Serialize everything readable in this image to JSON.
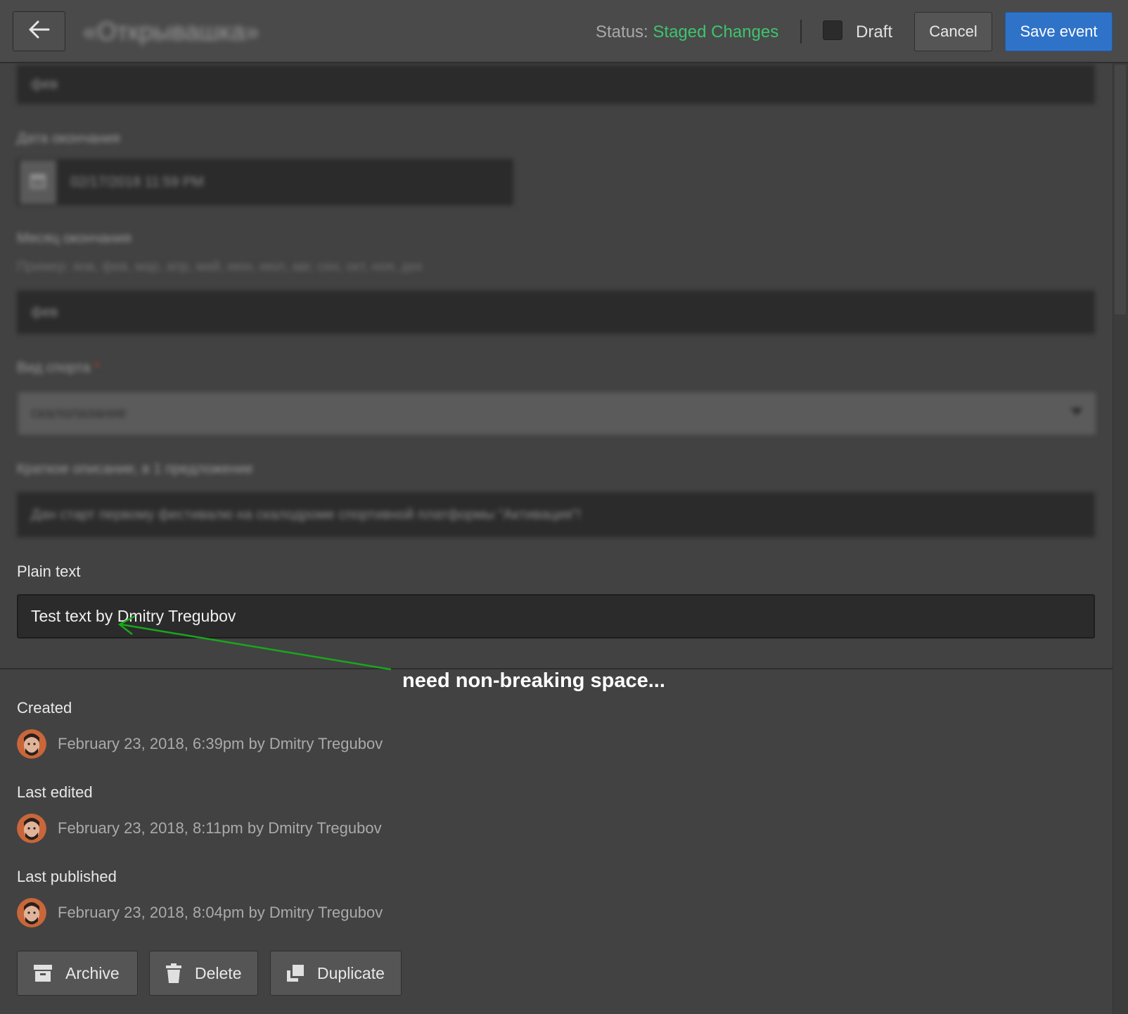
{
  "header": {
    "title": "«Открывашка»",
    "status_label": "Status:",
    "status_value": "Staged Changes",
    "draft_label": "Draft",
    "cancel_label": "Cancel",
    "save_label": "Save event"
  },
  "form": {
    "field_top_value": "фев",
    "end_date_label": "Дата окончания",
    "end_date_value": "02/17/2018 11:59 PM",
    "end_month_label": "Месяц окончания",
    "end_month_hint": "Пример: янв, фев, мар, апр, май, июн, июл, авг, сен, окт, ноя, дек",
    "end_month_value": "фев",
    "sport_label": "Вид спорта",
    "sport_required_mark": "*",
    "sport_value": "скалолазание",
    "short_desc_label": "Краткое описание, в 1 предложение",
    "short_desc_value": "Дан старт первому фестивалю на скалодроме спортивной платформы \"Активация\"!",
    "plain_text_label": "Plain text",
    "plain_text_value": "Test text by Dmitry Tregubov"
  },
  "annotation": {
    "text": "need non-breaking space...",
    "color": "#18a81a"
  },
  "meta": {
    "created_label": "Created",
    "created_value": "February 23, 2018, 6:39pm by Dmitry Tregubov",
    "edited_label": "Last edited",
    "edited_value": "February 23, 2018, 8:11pm by Dmitry Tregubov",
    "published_label": "Last published",
    "published_value": "February 23, 2018, 8:04pm by Dmitry Tregubov"
  },
  "actions": {
    "archive_label": "Archive",
    "delete_label": "Delete",
    "duplicate_label": "Duplicate"
  },
  "colors": {
    "accent": "#2f73c9",
    "status_ok": "#3ec46d",
    "background": "#424242"
  }
}
